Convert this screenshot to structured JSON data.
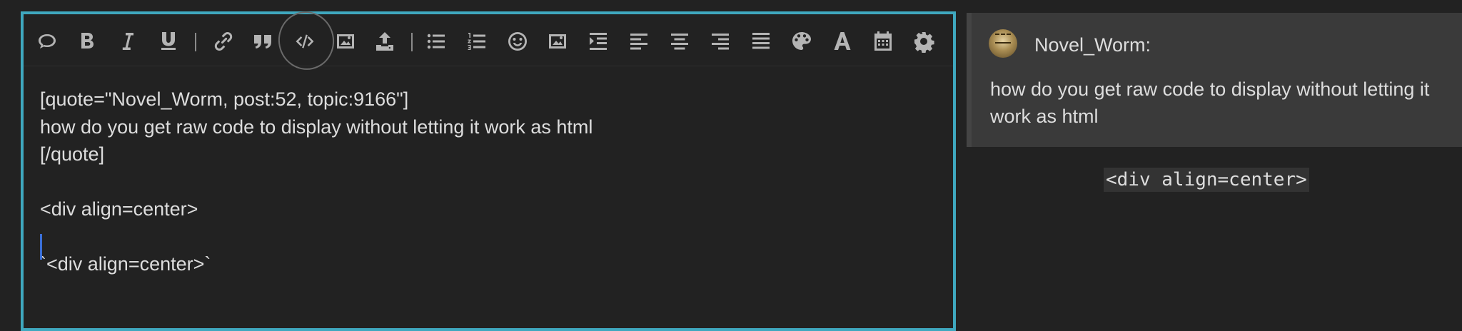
{
  "toolbar": {
    "buttons": [
      {
        "name": "quote-button",
        "icon": "speech-bubble-icon"
      },
      {
        "name": "bold-button",
        "icon": "bold-icon"
      },
      {
        "name": "italic-button",
        "icon": "italic-icon"
      },
      {
        "name": "underline-button",
        "icon": "underline-icon"
      },
      {
        "name": "link-button",
        "icon": "link-icon"
      },
      {
        "name": "blockquote-button",
        "icon": "quote-marks-icon"
      },
      {
        "name": "preformatted-code-button",
        "icon": "code-icon"
      },
      {
        "name": "image-button",
        "icon": "image-icon"
      },
      {
        "name": "upload-button",
        "icon": "upload-icon"
      },
      {
        "name": "bullet-list-button",
        "icon": "bullet-list-icon"
      },
      {
        "name": "numbered-list-button",
        "icon": "numbered-list-icon"
      },
      {
        "name": "emoji-button",
        "icon": "smile-icon"
      },
      {
        "name": "insert-image-button",
        "icon": "image-icon"
      },
      {
        "name": "indent-button",
        "icon": "indent-icon"
      },
      {
        "name": "align-left-button",
        "icon": "align-left-icon"
      },
      {
        "name": "align-center-button",
        "icon": "align-center-icon"
      },
      {
        "name": "align-right-button",
        "icon": "align-right-icon"
      },
      {
        "name": "align-justify-button",
        "icon": "align-justify-icon"
      },
      {
        "name": "color-button",
        "icon": "palette-icon"
      },
      {
        "name": "font-button",
        "icon": "font-icon"
      },
      {
        "name": "date-button",
        "icon": "calendar-icon"
      },
      {
        "name": "options-button",
        "icon": "gear-icon"
      }
    ]
  },
  "editor": {
    "lines": [
      "[quote=\"Novel_Worm, post:52, topic:9166\"]",
      "how do you get raw code to display without letting it work as html",
      "[/quote]",
      "",
      "<div align=center>",
      "",
      "`<div align=center>`"
    ]
  },
  "preview": {
    "quote_user": "Novel_Worm:",
    "quote_text": "how do you get raw code to display without letting it work as html",
    "code_text": "<div align=center>"
  },
  "colors": {
    "background": "#222222",
    "editor_border": "#3fa8bf",
    "text": "#dddddd",
    "icon": "#b4b4b4",
    "caret": "#3a6fd8",
    "quote_background": "#3a3a3a"
  }
}
